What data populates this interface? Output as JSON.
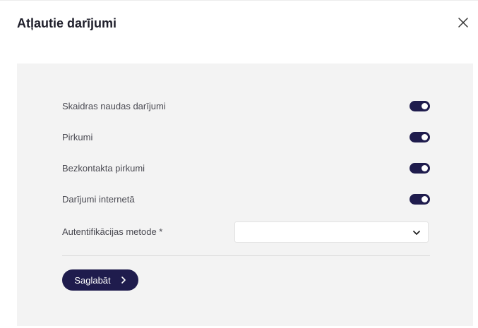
{
  "dialog": {
    "title": "Atļautie darījumi"
  },
  "toggles": [
    {
      "label": "Skaidras naudas darījumi",
      "enabled": true
    },
    {
      "label": "Pirkumi",
      "enabled": true
    },
    {
      "label": "Bezkontakta pirkumi",
      "enabled": true
    },
    {
      "label": "Darījumi internetā",
      "enabled": true
    }
  ],
  "auth_method": {
    "label": "Autentifikācijas metode *",
    "value": ""
  },
  "save_button": {
    "label": "Saglabāt"
  },
  "colors": {
    "accent": "#1f1c4d",
    "panel_background": "#f3f3f3"
  },
  "icons": {
    "close": "close-icon",
    "select_chevron": "chevron-down-icon",
    "button_chevron": "chevron-right-icon"
  }
}
